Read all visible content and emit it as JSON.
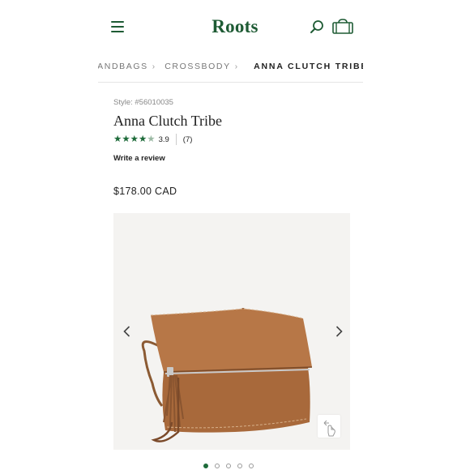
{
  "header": {
    "brand": "Roots",
    "menu_icon": "hamburger-menu-icon",
    "search_icon": "search-icon",
    "bag_icon": "shopping-bag-icon",
    "brand_color": "#1e5b34"
  },
  "breadcrumb": {
    "items": [
      "HANDBAGS",
      "CROSSBODY"
    ],
    "current": "ANNA CLUTCH TRIBE",
    "separator": "›"
  },
  "product": {
    "style_number": "Style: #56010035",
    "title": "Anna Clutch Tribe",
    "rating": {
      "stars_filled": 4,
      "stars_total": 5,
      "value": "3.9",
      "count": "(7)",
      "star_color": "#1e6b3a"
    },
    "write_review": "Write a review",
    "price": "$178.00 CAD"
  },
  "gallery": {
    "prev_icon": "chevron-left-icon",
    "next_icon": "chevron-right-icon",
    "zoom_icon": "tap-zoom-icon",
    "image_alt": "brown suede foldover crossbody clutch with tassel",
    "slide_count": 5,
    "active_slide": 1,
    "active_dot_color": "#1e6b3a"
  }
}
